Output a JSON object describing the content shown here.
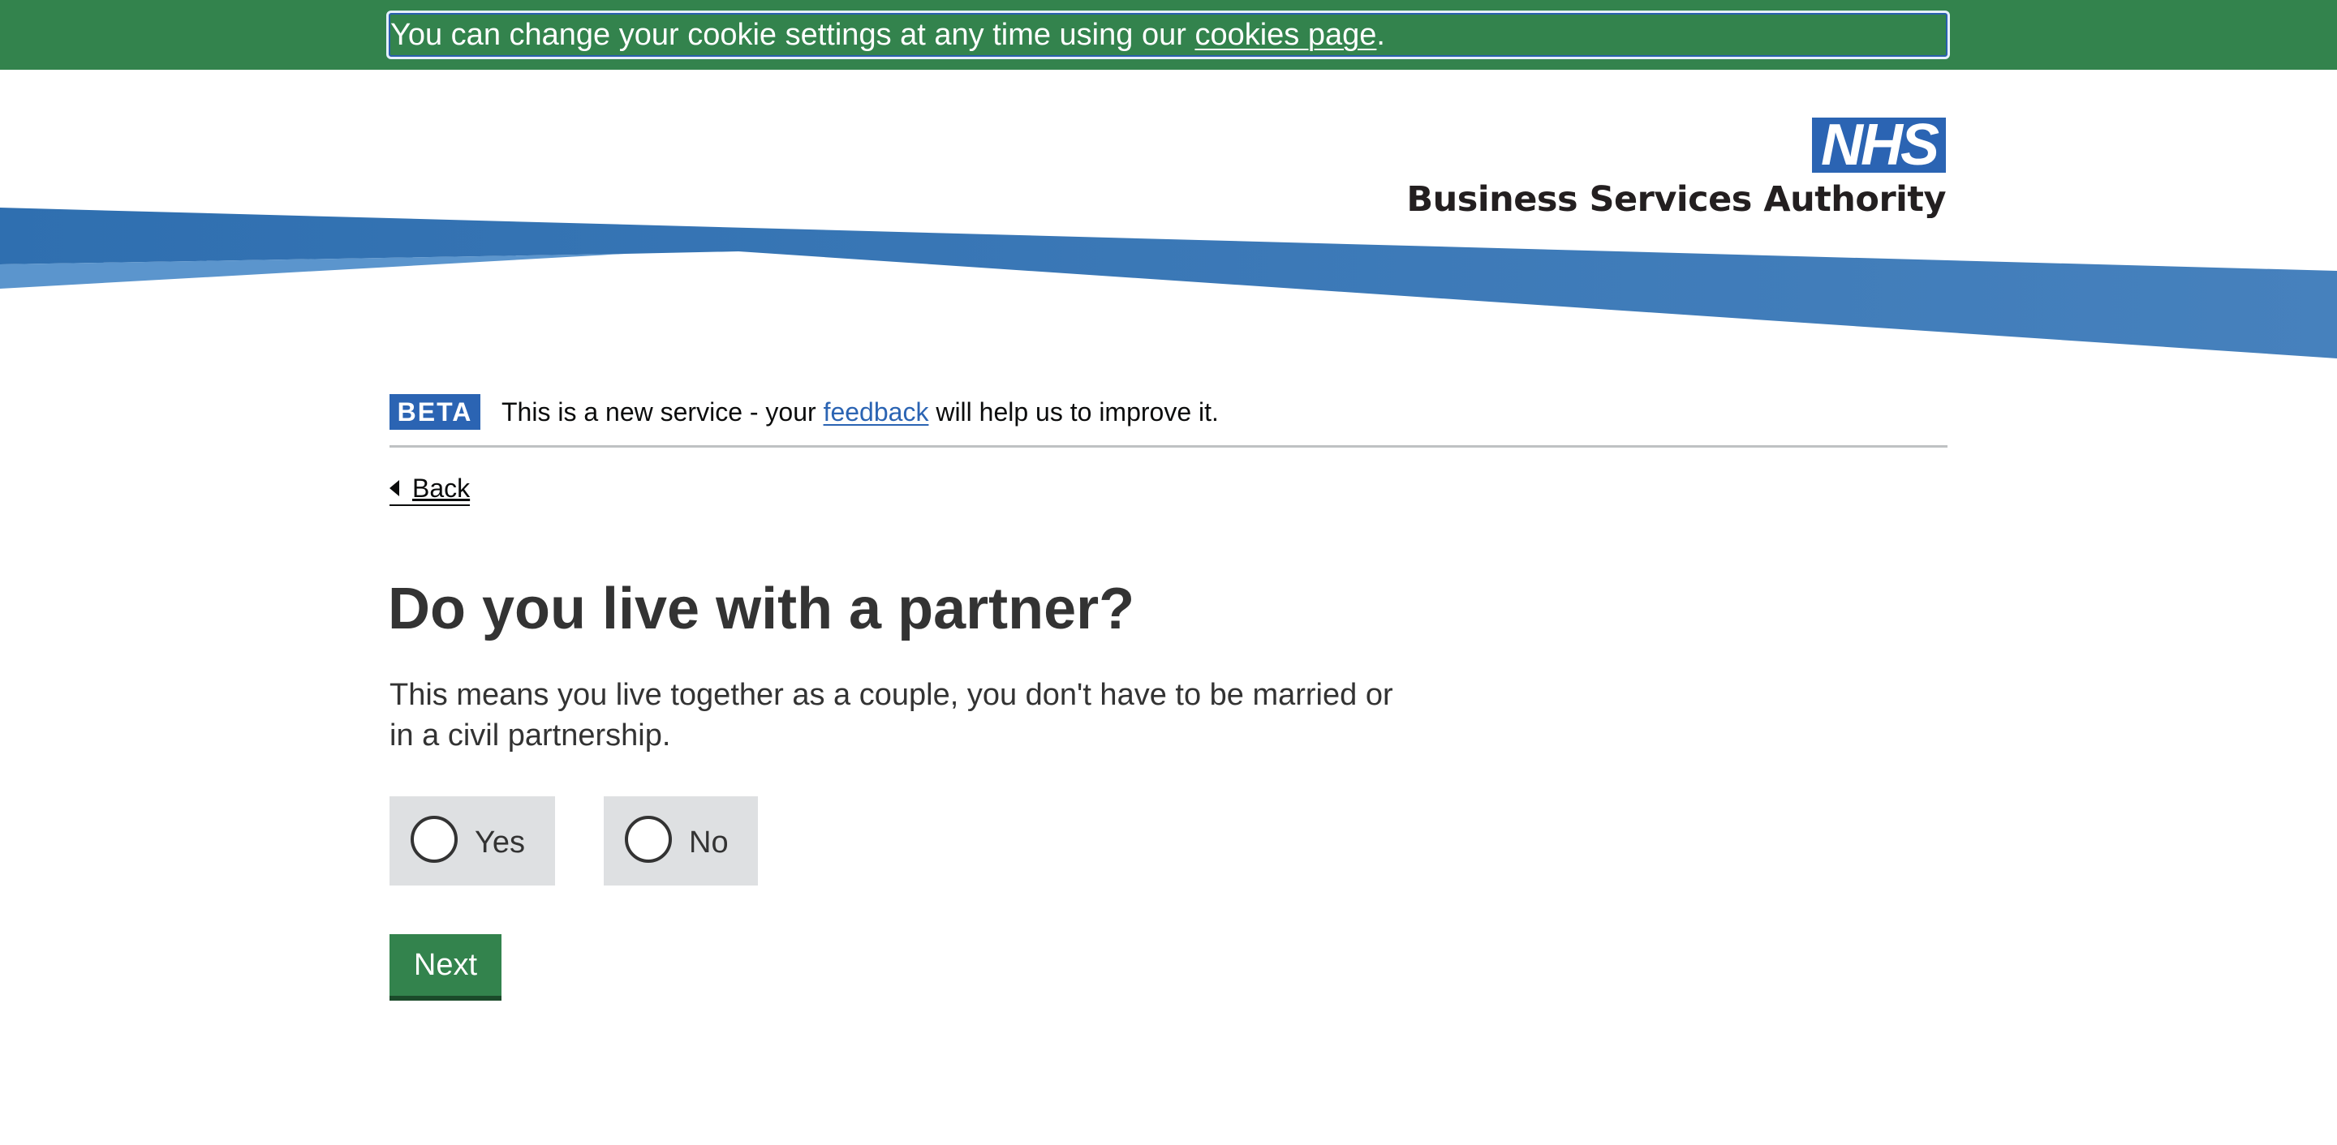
{
  "cookie_banner": {
    "text_before": "You can change your cookie settings at any time using our ",
    "link_label": "cookies page",
    "text_after": "."
  },
  "header": {
    "logo_text": "NHS",
    "org_name": "Business Services Authority",
    "colors": {
      "brand_blue": "#2b64b3",
      "swoosh_blue": "#3578b8"
    }
  },
  "phase_banner": {
    "tag": "BETA",
    "text_before": "This is a new service - your ",
    "link_label": "feedback",
    "text_after": " will help us to improve it."
  },
  "back_link": {
    "label": "Back",
    "icon": "chevron-left-icon"
  },
  "question": {
    "heading": "Do you live with a partner?",
    "hint": "This means you live together as a couple, you don't have to be married or in a civil partnership.",
    "options": [
      {
        "label": "Yes",
        "selected": false
      },
      {
        "label": "No",
        "selected": false
      }
    ]
  },
  "actions": {
    "next_label": "Next"
  },
  "colors": {
    "cookie_banner_bg": "#33834d",
    "button_green": "#33834d",
    "radio_bg": "#dee0e2",
    "text": "#333333"
  }
}
